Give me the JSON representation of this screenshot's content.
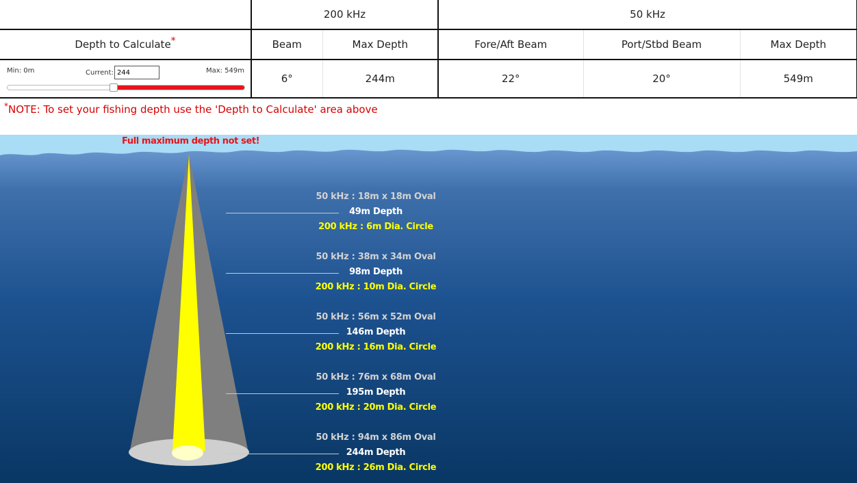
{
  "table": {
    "freq_200": "200 kHz",
    "freq_50": "50 kHz",
    "headers": {
      "depth_to_calculate": "Depth to Calculate",
      "asterisk": "*",
      "beam": "Beam",
      "max_depth_200": "Max Depth",
      "fore_aft": "Fore/Aft Beam",
      "port_stbd": "Port/Stbd Beam",
      "max_depth_50": "Max Depth"
    },
    "calculator": {
      "min_label": "Min: 0m",
      "current_label": "Current:",
      "current_value": "244",
      "max_label": "Max: 549m",
      "slider_fraction": 0.4444
    },
    "values": {
      "beam_200": "6°",
      "max_depth_200": "244m",
      "fore_aft_50": "22°",
      "port_stbd_50": "20°",
      "max_depth_50": "549m"
    }
  },
  "note": {
    "star": "*",
    "text": "NOTE: To set your fishing depth use the 'Depth to Calculate' area above"
  },
  "diagram": {
    "warning": "Full maximum depth not set!",
    "levels": [
      {
        "oval": "50 kHz : 18m x 18m Oval",
        "depth": "49m Depth",
        "circle": "200 kHz : 6m Dia. Circle"
      },
      {
        "oval": "50 kHz : 38m x 34m Oval",
        "depth": "98m Depth",
        "circle": "200 kHz : 10m Dia. Circle"
      },
      {
        "oval": "50 kHz : 56m x 52m Oval",
        "depth": "146m Depth",
        "circle": "200 kHz : 16m Dia. Circle"
      },
      {
        "oval": "50 kHz : 76m x 68m Oval",
        "depth": "195m Depth",
        "circle": "200 kHz : 20m Dia. Circle"
      },
      {
        "oval": "50 kHz : 94m x 86m Oval",
        "depth": "244m Depth",
        "circle": "200 kHz : 26m Dia. Circle"
      }
    ]
  },
  "colors": {
    "accent_red": "#e8141a",
    "wide_beam": "#7f7f7f",
    "narrow_beam": "#ffff00",
    "water_top": "#5b8ec8",
    "water_bottom": "#0a3a6b"
  }
}
